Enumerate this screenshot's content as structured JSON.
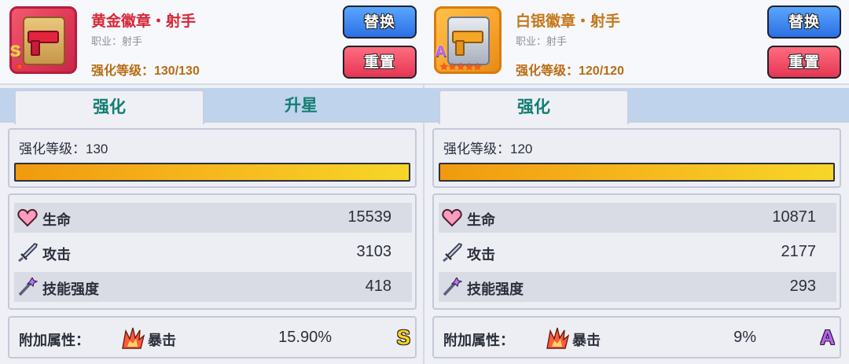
{
  "left": {
    "name": "黄金徽章・射手",
    "job": "职业：射手",
    "enhance_level": "强化等级：130/130",
    "rank": "S",
    "stars": "★",
    "replace_label": "替换",
    "reset_label": "重置",
    "tabs": [
      "强化",
      "升星"
    ],
    "level_text": "强化等级：130",
    "level_progress": 1.0,
    "stats": [
      {
        "label": "生命",
        "value": "15539",
        "icon": "heart-icon"
      },
      {
        "label": "攻击",
        "value": "3103",
        "icon": "sword-icon"
      },
      {
        "label": "技能强度",
        "value": "418",
        "icon": "wand-icon"
      }
    ],
    "extra": {
      "label": "附加属性：",
      "stat": "暴击",
      "value": "15.90%",
      "rank": "S",
      "icon": "crit-icon"
    }
  },
  "right": {
    "name": "白银徽章・射手",
    "job": "职业：射手",
    "enhance_level": "强化等级：120/120",
    "rank": "A",
    "stars": "★★★★★",
    "replace_label": "替换",
    "reset_label": "重置",
    "tabs": [
      "强化"
    ],
    "level_text": "强化等级：120",
    "level_progress": 1.0,
    "stats": [
      {
        "label": "生命",
        "value": "10871",
        "icon": "heart-icon"
      },
      {
        "label": "攻击",
        "value": "2177",
        "icon": "sword-icon"
      },
      {
        "label": "技能强度",
        "value": "293",
        "icon": "wand-icon"
      }
    ],
    "extra": {
      "label": "附加属性：",
      "stat": "暴击",
      "value": "9%",
      "rank": "A",
      "icon": "crit-icon"
    }
  }
}
